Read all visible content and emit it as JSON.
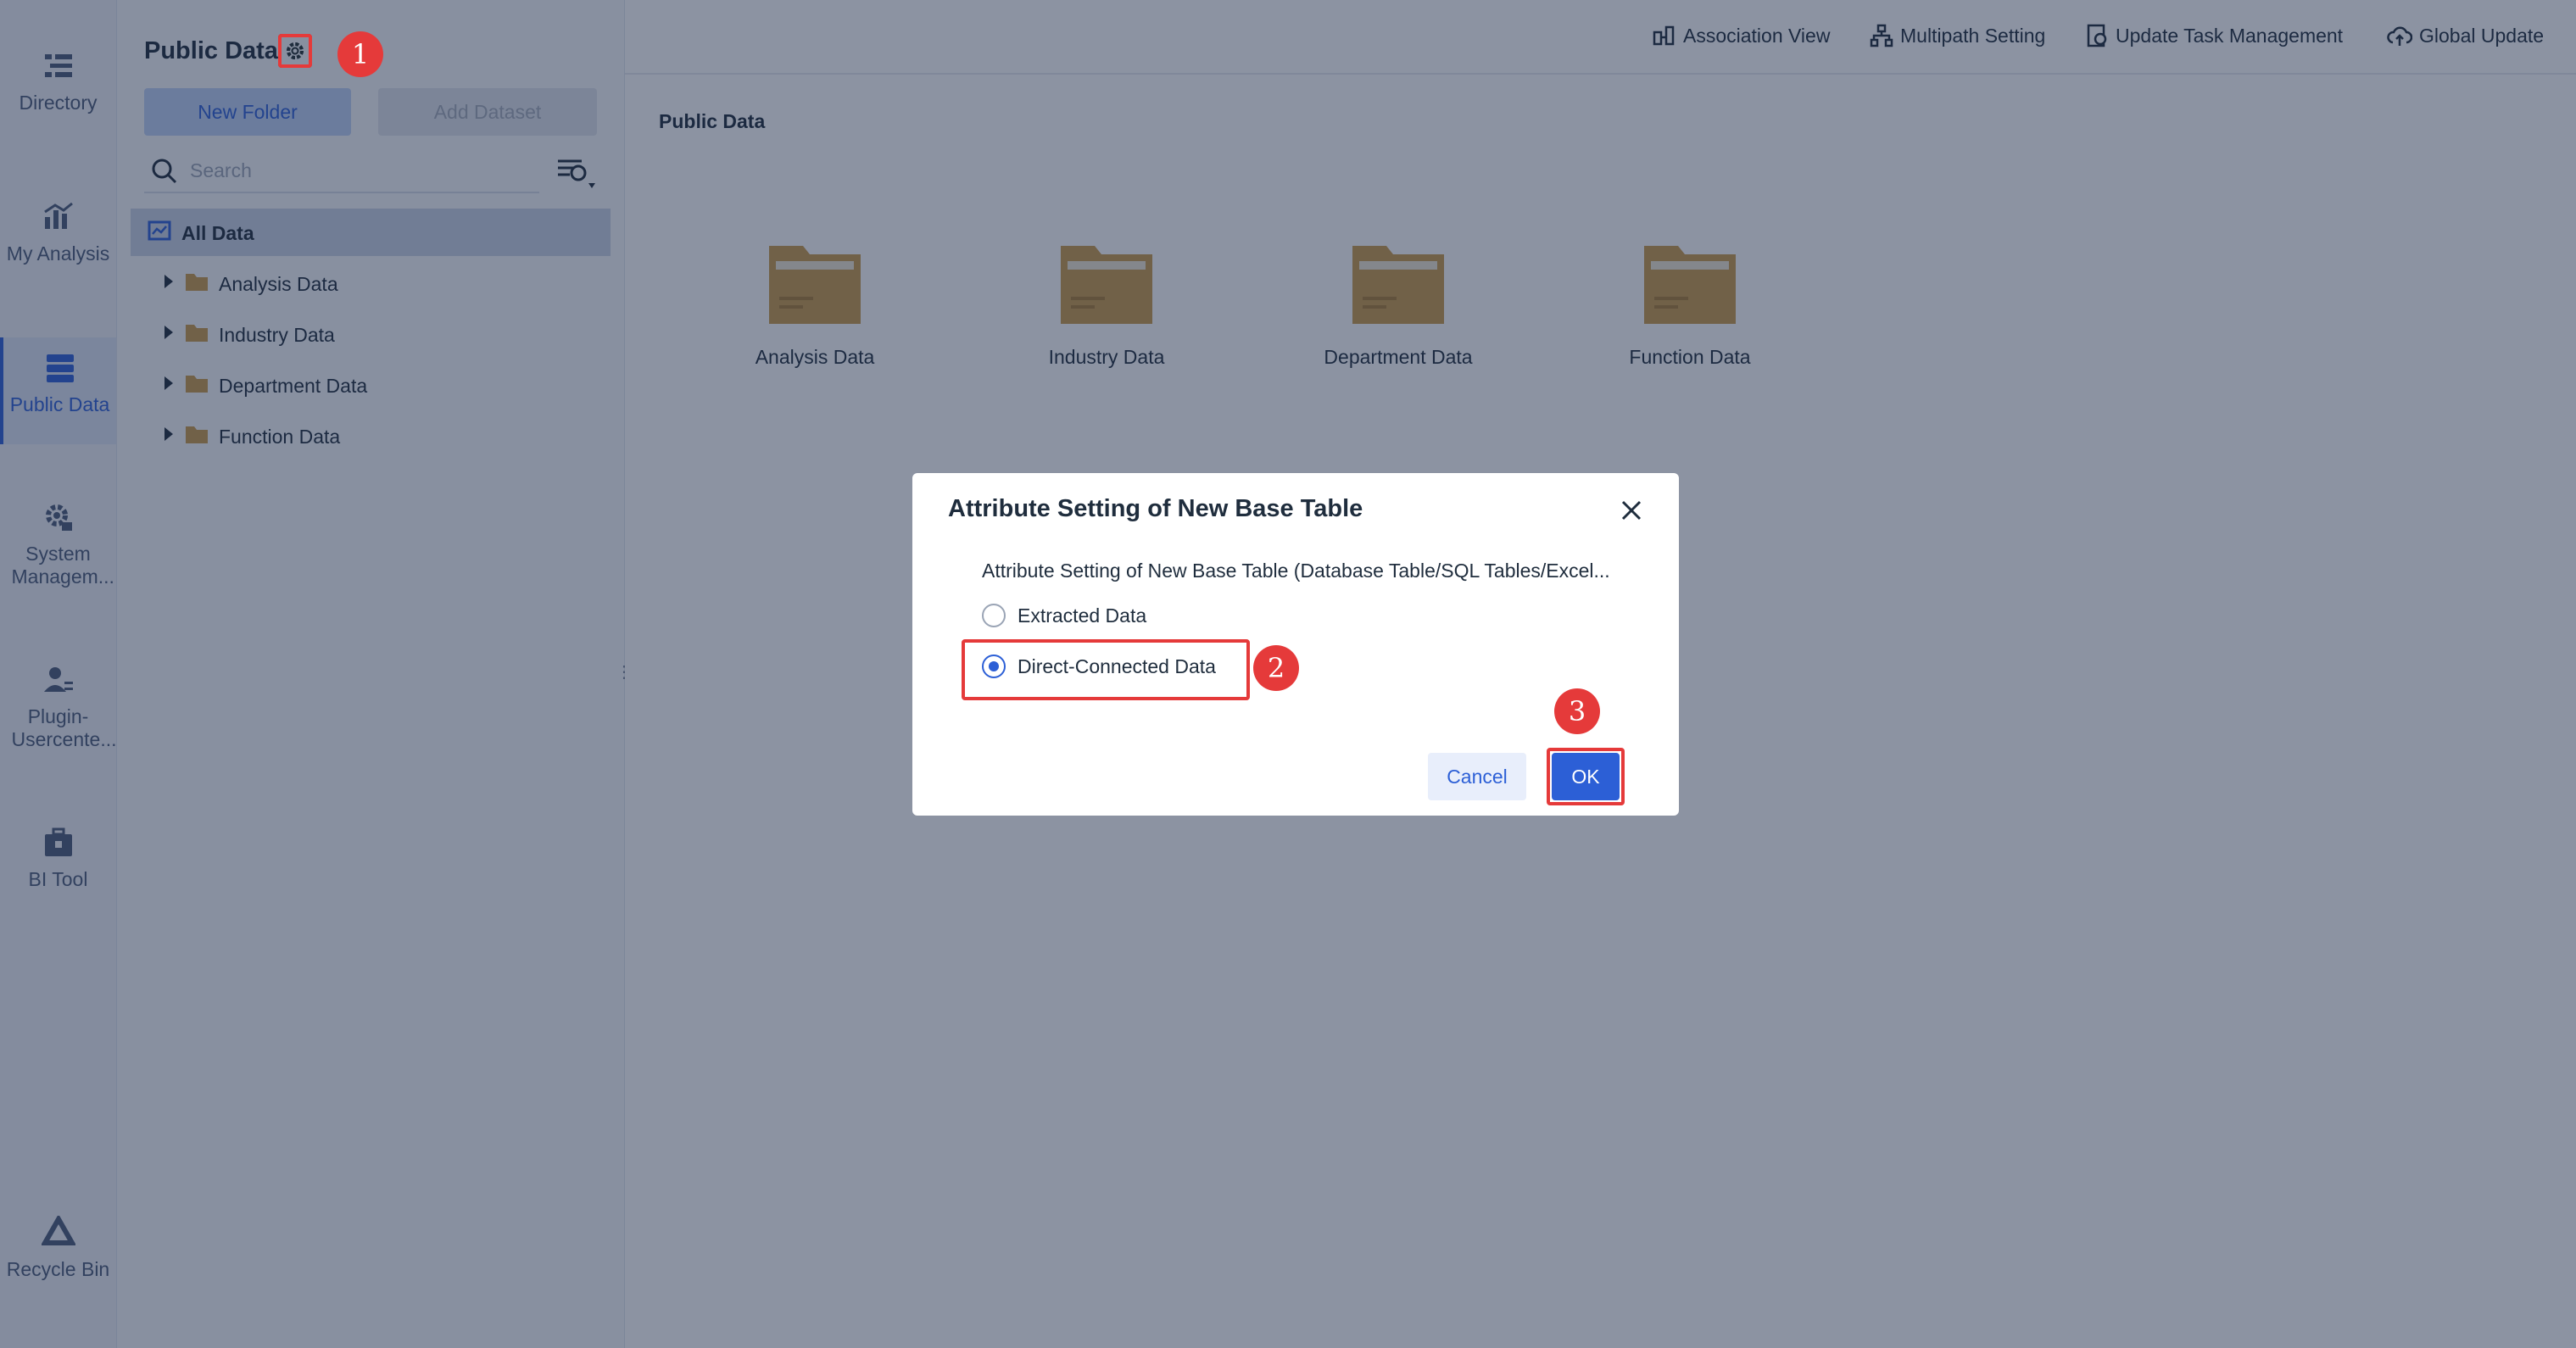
{
  "leftnav": {
    "items": [
      {
        "label": "Directory",
        "icon": "directory-icon"
      },
      {
        "label": "My Analysis",
        "icon": "analysis-icon"
      },
      {
        "label": "Public Data",
        "icon": "public-data-icon"
      },
      {
        "label": "System Managem...",
        "icon": "system-management-icon"
      },
      {
        "label": "Plugin-Usercente...",
        "icon": "plugin-user-icon"
      },
      {
        "label": "BI Tool",
        "icon": "toolbox-icon"
      },
      {
        "label": "Recycle Bin",
        "icon": "recycle-bin-icon"
      }
    ],
    "active_index": 2
  },
  "panel": {
    "title": "Public Data",
    "new_folder": "New Folder",
    "add_dataset": "Add Dataset",
    "search_placeholder": "Search",
    "tree": {
      "root": "All Data",
      "children": [
        "Analysis Data",
        "Industry Data",
        "Department Data",
        "Function Data"
      ]
    }
  },
  "topbar": {
    "items": [
      "Association View",
      "Multipath Setting",
      "Update Task Management",
      "Global Update"
    ]
  },
  "main": {
    "breadcrumb": "Public Data",
    "folders": [
      "Analysis Data",
      "Industry Data",
      "Department Data",
      "Function Data"
    ]
  },
  "dialog": {
    "title": "Attribute Setting of New Base Table",
    "description": "Attribute Setting of New Base Table (Database Table/SQL Tables/Excel...",
    "options": [
      "Extracted Data",
      "Direct-Connected Data"
    ],
    "selected_index": 1,
    "cancel": "Cancel",
    "ok": "OK"
  },
  "steps": [
    "1",
    "2",
    "3"
  ],
  "colors": {
    "accent": "#2c5fd6",
    "highlight": "#e53a3a",
    "folder": "#c99a4b"
  }
}
